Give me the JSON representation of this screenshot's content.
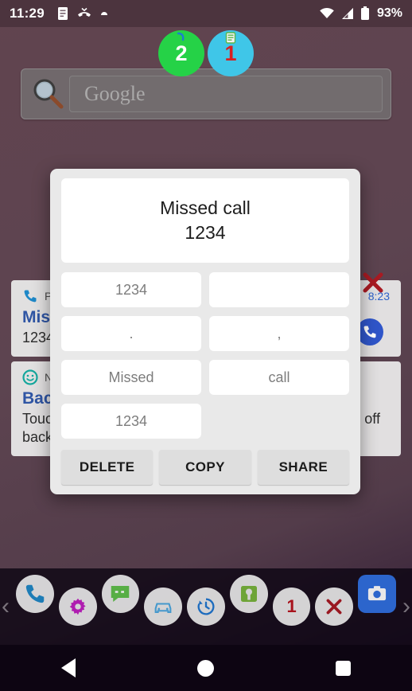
{
  "status_bar": {
    "clock": "11:29",
    "battery_percent": "93%",
    "left_icons": [
      "document-icon",
      "missed-call-icon",
      "dot-icon"
    ],
    "right_icons": [
      "wifi-icon",
      "cell-signal-icon",
      "battery-icon"
    ]
  },
  "badges": [
    {
      "count": "2",
      "color": "#25d247",
      "text_color": "#ffffff",
      "mini_icon": "hook-icon"
    },
    {
      "count": "1",
      "color": "#3fc6e8",
      "text_color": "#d81f1f",
      "mini_icon": "clipboard-icon"
    }
  ],
  "search_widget": {
    "icon": "magnifier-icon",
    "placeholder": "Google"
  },
  "notifications": [
    {
      "app_icon": "phone-icon",
      "app_name": "Phone",
      "time": "8:23",
      "title": "Missed call",
      "body": "1234",
      "action_icon": "callback-icon",
      "dismiss_icon": "close-x-icon"
    },
    {
      "app_icon": "smiley-icon",
      "app_name": "N",
      "time": "",
      "title": "Background Service",
      "body": "Touch to go to the application settings where you turn off background service notification in notification settings",
      "action_icon": "",
      "dismiss_icon": ""
    }
  ],
  "dialog": {
    "title_line1": "Missed call",
    "title_line2": "1234",
    "tokens": [
      "1234",
      "",
      ".",
      ",",
      "Missed",
      "call",
      "1234"
    ],
    "actions": [
      {
        "label": "DELETE",
        "name": "delete-button"
      },
      {
        "label": "COPY",
        "name": "copy-button"
      },
      {
        "label": "SHARE",
        "name": "share-button"
      }
    ]
  },
  "dock": {
    "left_chevron": "‹",
    "right_chevron": "›",
    "items": [
      {
        "icon": "phone-icon",
        "label": ""
      },
      {
        "icon": "settings-gear-icon",
        "label": ""
      },
      {
        "icon": "messages-icon",
        "label": ""
      },
      {
        "icon": "car-icon",
        "label": ""
      },
      {
        "icon": "call-history-icon",
        "label": ""
      },
      {
        "icon": "android-box-icon",
        "label": ""
      },
      {
        "icon": "count-badge-icon",
        "label": "1"
      },
      {
        "icon": "close-x-icon",
        "label": ""
      },
      {
        "icon": "camera-icon",
        "label": ""
      }
    ]
  },
  "nav_bar": {
    "back": "back-triangle-icon",
    "home": "home-circle-icon",
    "recents": "recents-square-icon"
  },
  "colors": {
    "wallpaper": "#5d4450",
    "dialog_bg": "#e9e9e9",
    "card_bg": "#ffffff",
    "token_text": "#7d7d7d",
    "notif_title": "#2f55a4",
    "accent_red": "#b8141e"
  }
}
